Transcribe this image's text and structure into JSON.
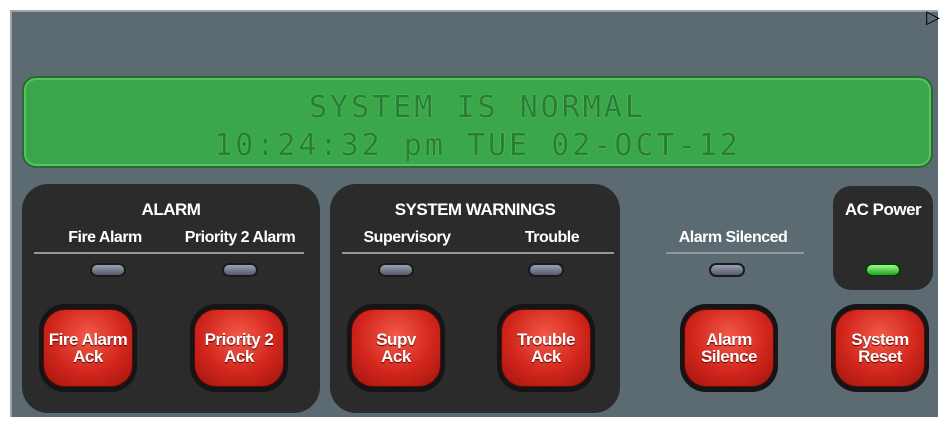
{
  "lcd": {
    "line1": "SYSTEM IS NORMAL",
    "line2": "10:24:32 pm  TUE 02-OCT-12"
  },
  "alarm_group": {
    "title": "ALARM",
    "labels": [
      "Fire Alarm",
      "Priority 2 Alarm"
    ],
    "buttons": [
      {
        "line1": "Fire Alarm",
        "line2": "Ack"
      },
      {
        "line1": "Priority 2",
        "line2": "Ack"
      }
    ]
  },
  "warnings_group": {
    "title": "SYSTEM WARNINGS",
    "labels": [
      "Supervisory",
      "Trouble"
    ],
    "buttons": [
      {
        "line1": "Supv",
        "line2": "Ack"
      },
      {
        "line1": "Trouble",
        "line2": "Ack"
      }
    ]
  },
  "alarm_silenced": {
    "label": "Alarm Silenced",
    "button": {
      "line1": "Alarm",
      "line2": "Silence"
    }
  },
  "ac_power": {
    "label": "AC Power",
    "led_state": "on"
  },
  "system_reset": {
    "button": {
      "line1": "System",
      "line2": "Reset"
    }
  },
  "colors": {
    "panel": "#5c6b72",
    "lcd": "#3aa84a",
    "button_red": "#d2261c",
    "led_on": "#22a020",
    "led_off": "#55596a"
  },
  "corner_icon": "expand-arrow-icon"
}
